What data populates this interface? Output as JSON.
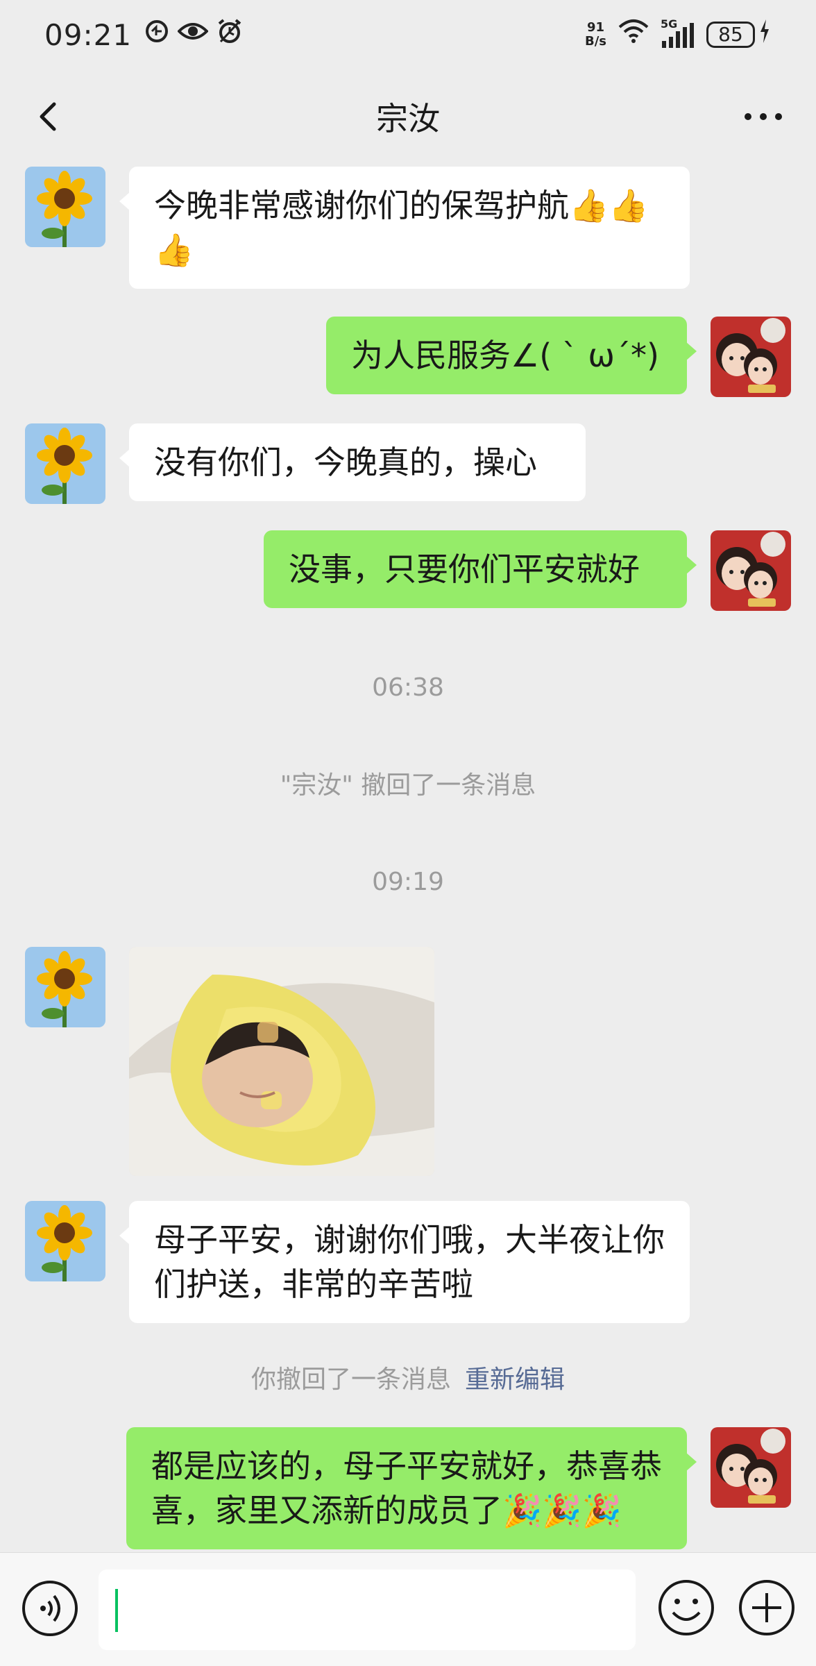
{
  "status_bar": {
    "time": "09:21",
    "net_speed_value": "91",
    "net_speed_unit": "B/s",
    "network_type": "5G",
    "battery": "85",
    "left_icons": [
      "notification-icon",
      "eye-icon",
      "alarm-icon"
    ],
    "right_icons": [
      "wifi-icon",
      "signal-icon",
      "charging-icon"
    ]
  },
  "nav": {
    "title": "宗汝",
    "back_icon": "back-chevron-icon",
    "more_icon": "more-dots-icon"
  },
  "messages": [
    {
      "direction": "in",
      "text": "今晚非常感谢你们的保驾护航👍👍👍"
    },
    {
      "direction": "out",
      "text": "为人民服务∠( ˋ ω´*)"
    },
    {
      "direction": "in",
      "text": "没有你们，今晚真的，操心"
    },
    {
      "direction": "out",
      "text": "没事，只要你们平安就好"
    },
    {
      "type": "time",
      "text": "06:38"
    },
    {
      "type": "system",
      "text": "\"宗汝\" 撤回了一条消息"
    },
    {
      "type": "time",
      "text": "09:19"
    },
    {
      "direction": "in",
      "type": "image",
      "text": ""
    },
    {
      "direction": "in",
      "text": "母子平安，谢谢你们哦，大半夜让你们护送，非常的辛苦啦"
    },
    {
      "type": "system",
      "text": "你撤回了一条消息",
      "link": "重新编辑"
    },
    {
      "direction": "out",
      "text": "都是应该的，母子平安就好，恭喜恭喜，家里又添新的成员了🎉🎉🎉"
    }
  ],
  "input_bar": {
    "placeholder": "",
    "voice_icon": "voice-icon",
    "emoji_icon": "emoji-icon",
    "plus_icon": "plus-icon"
  },
  "colors": {
    "background": "#ededed",
    "bubble_out": "#95ec69",
    "bubble_in": "#ffffff",
    "system_text": "#9b9b9b",
    "link": "#576b95"
  }
}
